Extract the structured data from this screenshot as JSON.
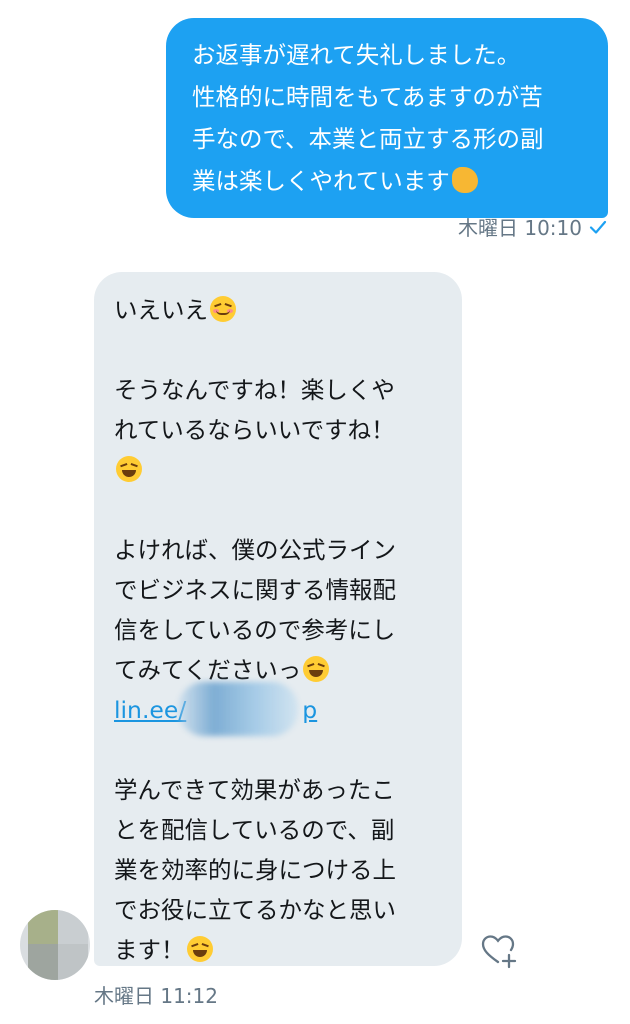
{
  "sent_message": {
    "lines": [
      "お返事が遅れて失礼しました。",
      "性格的に時間をもてあますのが苦",
      "手なので、本業と両立する形の副",
      "業は楽しくやれています"
    ],
    "emoji": "flexed-biceps",
    "time": "木曜日 10:10",
    "status_icon": "check-icon"
  },
  "received_message": {
    "para1": "いえいえ",
    "para1_emoji": "smiling-face-blushing",
    "para2_lines": [
      "そうなんですね！楽しくや",
      "れているならいいですね！"
    ],
    "para2_emoji": "grinning-squinting-face",
    "para3_lines": [
      "よければ、僕の公式ライン",
      "でビジネスに関する情報配",
      "信をしているので参考にし",
      "てみてくださいっ"
    ],
    "para3_emoji": "grinning-squinting-face",
    "link_text": "lin.ee/",
    "link_text_tail": "p",
    "para4_lines": [
      "学んできて効果があったこ",
      "とを配信しているので、副",
      "業を効率的に身につける上",
      "でお役に立てるかなと思い",
      "ます！"
    ],
    "para4_emoji": "grinning-squinting-face",
    "time": "木曜日 11:12"
  },
  "reaction_icon": "heart-plus-icon",
  "colors": {
    "sent_bubble": "#1da1f2",
    "received_bubble": "#e6ecf0",
    "link": "#1b95e0",
    "meta_text": "#657786"
  }
}
